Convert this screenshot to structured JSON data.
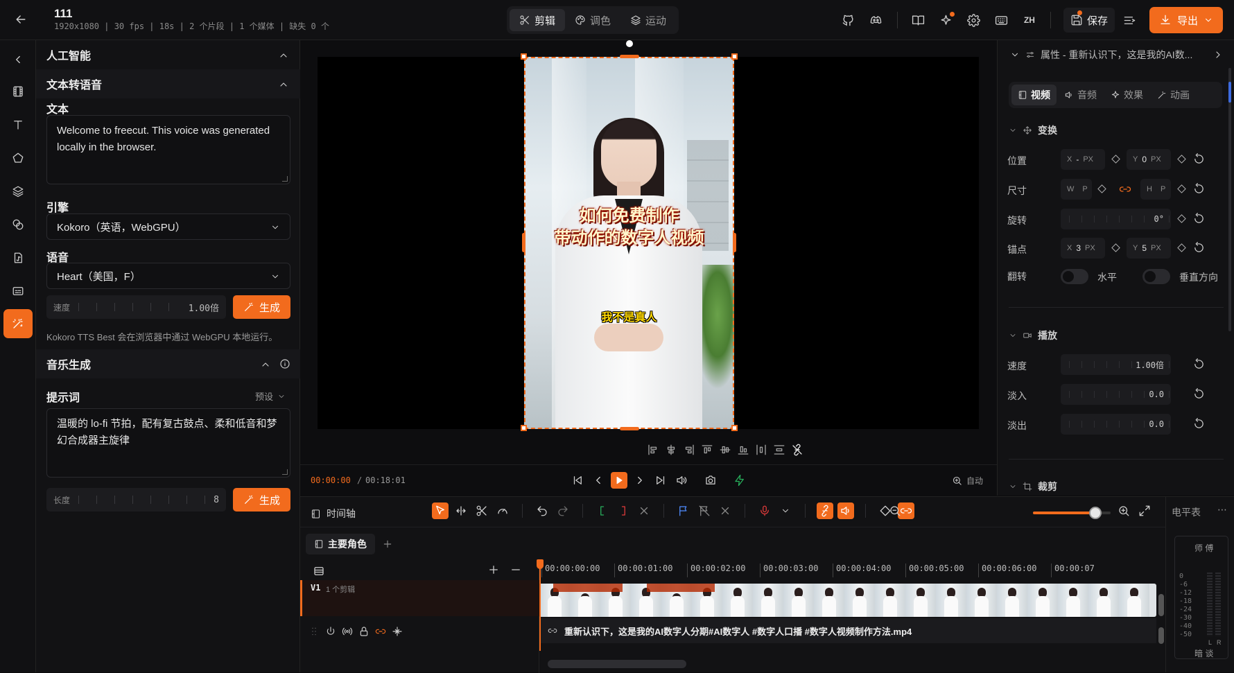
{
  "topbar": {
    "title": "111",
    "meta": "1920x1080 | 30 fps | 18s | 2 个片段 | 1 个媒体 | 缺失 0 个",
    "modes": [
      {
        "label": "剪辑",
        "icon": "scissors-icon",
        "active": true
      },
      {
        "label": "调色",
        "icon": "palette-icon",
        "active": false
      },
      {
        "label": "运动",
        "icon": "layers-icon",
        "active": false
      }
    ],
    "lang": "ZH",
    "save_label": "保存",
    "export_label": "导出"
  },
  "left_panel": {
    "ai_title": "人工智能",
    "tts_title": "文本转语音",
    "text_label": "文本",
    "text_value": "Welcome to freecut. This voice was generated locally in the browser.",
    "engine_label": "引擎",
    "engine_value": "Kokoro（英语，WebGPU）",
    "voice_label": "语音",
    "voice_value": "Heart（美国，F）",
    "speed_label": "速度",
    "speed_value": "1.00倍",
    "generate_label": "生成",
    "tts_note": "Kokoro TTS Best 会在浏览器中通过 WebGPU 本地运行。",
    "music_title": "音乐生成",
    "prompt_label": "提示词",
    "preset_label": "预设",
    "prompt_value": "温暖的 lo-fi 节拍，配有复古鼓点、柔和低音和梦幻合成器主旋律",
    "length_label": "长度",
    "length_value": "8",
    "generate2_label": "生成"
  },
  "preview": {
    "caption_title_line1": "如何免费制作",
    "caption_title_line2": "带动作的数字人视频",
    "caption_sub": "我不是真人",
    "time_current": "00:00:00",
    "time_sep": "/",
    "time_total": "00:18:01",
    "zoom_label": "自动"
  },
  "properties": {
    "header": "属性 - 重新认识下，这是我的AI数...",
    "tabs": [
      {
        "label": "视频",
        "active": true
      },
      {
        "label": "音频",
        "active": false
      },
      {
        "label": "效果",
        "active": false
      },
      {
        "label": "动画",
        "active": false
      }
    ],
    "transform_title": "变换",
    "position_label": "位置",
    "pos_x": {
      "axis": "X",
      "value": "-",
      "unit": "PX"
    },
    "pos_y": {
      "axis": "Y",
      "value": "0",
      "unit": "PX"
    },
    "size_label": "尺寸",
    "size_w": {
      "axis": "W",
      "value": "",
      "unit": "P"
    },
    "size_h": {
      "axis": "H",
      "value": "",
      "unit": "P"
    },
    "rotation_label": "旋转",
    "rotation_value": "0°",
    "anchor_label": "锚点",
    "anchor_x": {
      "axis": "X",
      "value": "3",
      "unit": "PX"
    },
    "anchor_y": {
      "axis": "Y",
      "value": "5",
      "unit": "PX"
    },
    "flip_label": "翻转",
    "flip_h_label": "水平",
    "flip_v_label": "垂直方向",
    "playback_title": "播放",
    "speed_label": "速度",
    "speed_value": "1.00倍",
    "fadein_label": "淡入",
    "fadein_value": "0.0",
    "fadeout_label": "淡出",
    "fadeout_value": "0.0",
    "crop_title": "裁剪"
  },
  "timeline": {
    "title": "时间轴",
    "scene_tab": "主要角色",
    "ruler": [
      "00:00:00:00",
      "00:00:01:00",
      "00:00:02:00",
      "00:00:03:00",
      "00:00:04:00",
      "00:00:05:00",
      "00:00:06:00",
      "00:00:07"
    ],
    "track_name": "V1",
    "track_count": "1 个剪辑",
    "clip_name": "重新认识下，这是我的AI数字人分期#AI数字人 #数字人口播 #数字人视频制作方法.mp4",
    "zoom_level": 0.8
  },
  "meter": {
    "title": "电平表",
    "top_label": "师 傅",
    "db_scale": [
      "0",
      "-6",
      "-12",
      "-18",
      "-24",
      "-30",
      "-40",
      "-50"
    ],
    "left": "L",
    "right": "R",
    "bottom_label": "暗 谈"
  },
  "colors": {
    "accent": "#f26b1d",
    "bg": "#0b0b0c",
    "panel": "#121214"
  }
}
